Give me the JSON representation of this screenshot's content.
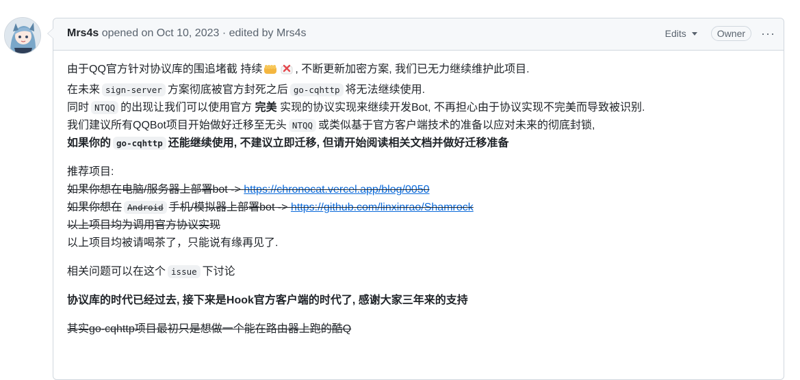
{
  "header": {
    "author": "Mrs4s",
    "meta": "opened on Oct 10, 2023 · edited by Mrs4s",
    "edits_label": "Edits",
    "owner_badge": "Owner",
    "more_label": "···"
  },
  "body": {
    "p1": {
      "l1a": "由于QQ官方针对协议库的围追堵截 持续",
      "l1b": ", 不断更新加密方案, 我们已无力继续维护此项目.",
      "l2a": "在未来",
      "l2_code1": "sign-server",
      "l2b": "方案彻底被官方封死之后",
      "l2_code2": "go-cqhttp",
      "l2c": "将无法继续使用.",
      "l3a": "同时",
      "l3_code": "NTQQ",
      "l3b": "的出现让我们可以使用官方",
      "l3_bold": "完美",
      "l3c": "实现的协议实现来继续开发Bot, 不再担心由于协议实现不完美而导致被识别.",
      "l4a": "我们建议所有QQBot项目开始做好迁移至无头",
      "l4_code": "NTQQ",
      "l4b": "或类似基于官方客户端技术的准备以应对未来的彻底封锁,",
      "l5a": "如果你的",
      "l5_code": "go-cqhttp",
      "l5b": "还能继续使用, 不建议立即迁移, 但请开始阅读相关文档并做好迁移准备"
    },
    "p2": {
      "title": "推荐项目:",
      "r1_text": "如果你想在电脑/服务器上部署bot -> ",
      "r1_link": "https://chronocat.vercel.app/blog/0050",
      "r2_text1": "如果你想在",
      "r2_code": "Android",
      "r2_text2": "手机/模拟器上部署bot -> ",
      "r2_link": "https://github.com/linxinrao/Shamrock",
      "r3": "以上项目均为调用官方协议实现",
      "r4": "以上项目均被请喝茶了，只能说有缘再见了."
    },
    "p3": {
      "text1": "相关问题可以在这个",
      "code": "issue",
      "text2": "下讨论"
    },
    "p4": "协议库的时代已经过去, 接下来是Hook官方客户端的时代了, 感谢大家三年来的支持",
    "p5": "其实go-cqhttp项目最初只是想做一个能在路由器上跑的酷Q"
  },
  "icons": [
    "avatar",
    "fist-emoji",
    "cross-mark-emoji",
    "caret-down-icon",
    "kebab-icon"
  ]
}
